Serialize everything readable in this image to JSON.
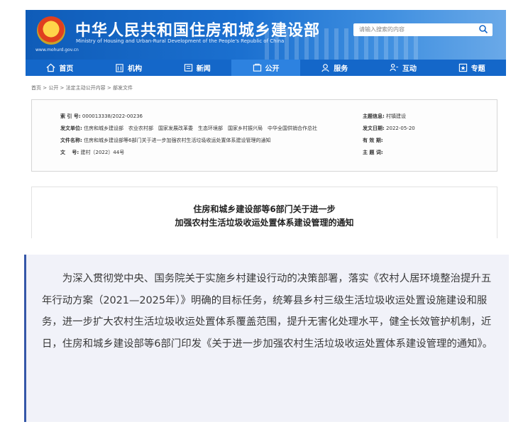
{
  "header": {
    "title_cn": "中华人民共和国住房和城乡建设部",
    "title_en": "Ministry of Housing and Urban-Rural Development of the People's Republic of China",
    "site_url": "www.mohurd.gov.cn",
    "search_placeholder": "请输入搜索的内容",
    "colors": {
      "primary": "#1467c9",
      "accent": "#3557a8"
    }
  },
  "nav": {
    "items": [
      {
        "label": "首页",
        "icon": "home-icon"
      },
      {
        "label": "机构",
        "icon": "building-icon"
      },
      {
        "label": "新闻",
        "icon": "news-icon"
      },
      {
        "label": "公开",
        "icon": "disclosure-icon",
        "active": true
      },
      {
        "label": "服务",
        "icon": "service-icon"
      },
      {
        "label": "互动",
        "icon": "interaction-icon"
      },
      {
        "label": "专题",
        "icon": "topic-icon"
      }
    ]
  },
  "breadcrumb": "首页 > 公开 > 法定主动公开内容 > 部发文件",
  "meta": {
    "index_label": "索 引 号:",
    "index_value": "000013338/2022-00236",
    "issuer_label": "发文单位:",
    "issuer_value": "住房和城乡建设部　农业农村部　国家发展改革委　生态环境部　国家乡村振兴局　中华全国供销合作总社",
    "docname_label": "文件名称:",
    "docname_value": "住房和城乡建设部等6部门关于进一步加强农村生活垃圾收运处置体系建设管理的通知",
    "docno_label": "文　 号:",
    "docno_value": "建村〔2022〕44号",
    "topic_label": "主题信息:",
    "topic_value": "村镇建设",
    "date_label": "发文日期:",
    "date_value": "2022-05-20",
    "valid_label": "有 效 期:",
    "valid_value": "",
    "subject_label": "主 题 词:",
    "subject_value": ""
  },
  "document": {
    "title_line1": "住房和城乡建设部等6部门关于进一步",
    "title_line2": "加强农村生活垃圾收运处置体系建设管理的通知"
  },
  "quote": {
    "text": "为深入贯彻党中央、国务院关于实施乡村建设行动的决策部署，落实《农村人居环境整治提升五年行动方案（2021—2025年）》明确的目标任务，统筹县乡村三级生活垃圾收运处置设施建设和服务，进一步扩大农村生活垃圾收运处置体系覆盖范围，提升无害化处理水平，健全长效管护机制，近日，住房和城乡建设部等6部门印发《关于进一步加强农村生活垃圾收运处置体系建设管理的通知》。"
  }
}
